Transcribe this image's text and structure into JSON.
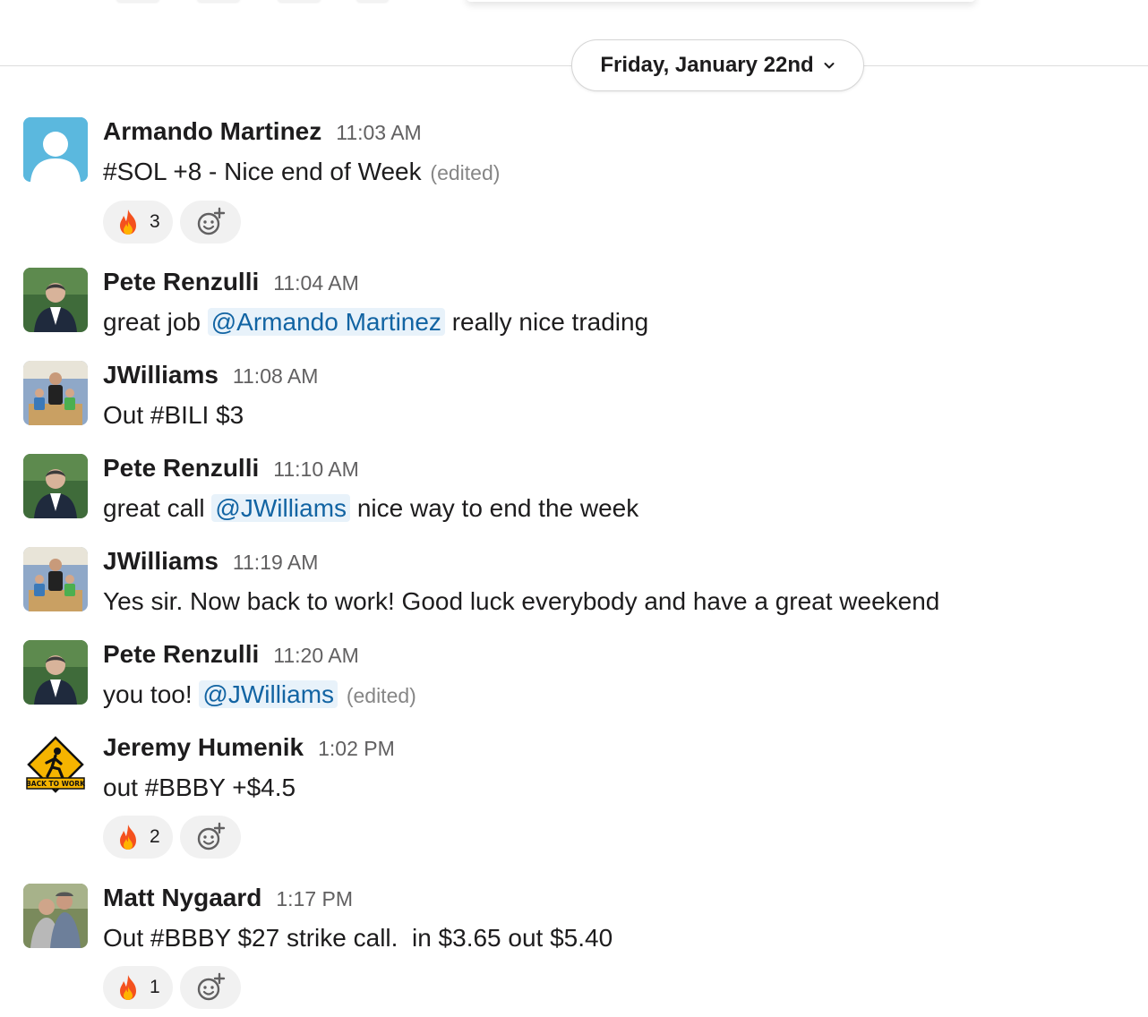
{
  "date_divider": {
    "label": "Friday, January 22nd"
  },
  "messages": [
    {
      "author": "Armando Martinez",
      "time": "11:03 AM",
      "text": "#SOL +8 - Nice end of Week",
      "edited": "(edited)",
      "avatar": "default-avatar",
      "reactions": [
        {
          "emoji": "fire",
          "count": "3"
        }
      ]
    },
    {
      "author": "Pete Renzulli",
      "time": "11:04 AM",
      "pre": "great job ",
      "mention": "@Armando Martinez",
      "post": " really nice trading",
      "avatar": "photo-man-suit"
    },
    {
      "author": "JWilliams",
      "time": "11:08 AM",
      "text": "Out #BILI $3",
      "avatar": "photo-family"
    },
    {
      "author": "Pete Renzulli",
      "time": "11:10 AM",
      "pre": "great call ",
      "mention": "@JWilliams",
      "post": " nice way to end the week",
      "avatar": "photo-man-suit"
    },
    {
      "author": "JWilliams",
      "time": "11:19 AM",
      "text": "Yes sir. Now back to work! Good luck everybody and have a great weekend",
      "avatar": "photo-family"
    },
    {
      "author": "Pete Renzulli",
      "time": "11:20 AM",
      "pre": "you too! ",
      "mention": "@JWilliams",
      "edited": "(edited)",
      "avatar": "photo-man-suit"
    },
    {
      "author": "Jeremy Humenik",
      "time": "1:02 PM",
      "text": "out #BBBY +$4.5",
      "avatar": "back-to-work-sign",
      "avatar_text": "BACK TO WORK",
      "reactions": [
        {
          "emoji": "fire",
          "count": "2"
        }
      ]
    },
    {
      "author": "Matt Nygaard",
      "time": "1:17 PM",
      "text": "Out #BBBY $27 strike call.  in $3.65 out $5.40",
      "avatar": "photo-couple",
      "reactions": [
        {
          "emoji": "fire",
          "count": "1"
        }
      ]
    }
  ],
  "colors": {
    "mention_bg": "#e8f2fa",
    "mention_text": "#1264a3",
    "default_avatar": "#5bb8de"
  }
}
